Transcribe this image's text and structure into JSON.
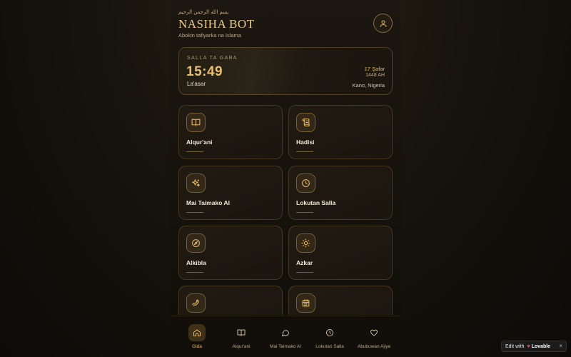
{
  "header": {
    "bismillah": "بسم الله الرحمن الرحيم",
    "title": "NASIHA BOT",
    "tagline": "Abokin tafiyarka na Islama",
    "profile_icon": "user-icon"
  },
  "prayer_card": {
    "label": "SALLA TA GABA",
    "time": "15:49",
    "name": "La'asar",
    "hijri_date": "17 Şafar",
    "hijri_year": "1448 AH",
    "location": "Kano, Nigeria"
  },
  "tiles": [
    {
      "label": "Alqur'ani",
      "icon": "book-open-icon"
    },
    {
      "label": "Hadisi",
      "icon": "scroll-icon"
    },
    {
      "label": "Mai Taimako AI",
      "icon": "sparkles-icon"
    },
    {
      "label": "Lokutan Salla",
      "icon": "clock-icon"
    },
    {
      "label": "Alkibla",
      "icon": "compass-icon"
    },
    {
      "label": "Azkar",
      "icon": "sun-icon"
    },
    {
      "label": "",
      "icon": "hand-coins-icon"
    },
    {
      "label": "",
      "icon": "calendar-icon"
    }
  ],
  "nav": {
    "items": [
      {
        "label": "Gida",
        "icon": "home-icon",
        "active": true
      },
      {
        "label": "Alqur'ani",
        "icon": "book-open-icon",
        "active": false
      },
      {
        "label": "Mai Taimako AI",
        "icon": "chat-bubble-icon",
        "active": false
      },
      {
        "label": "Lokutan Salla",
        "icon": "clock-icon",
        "active": false
      },
      {
        "label": "Abubuwan Ajiye",
        "icon": "heart-icon",
        "active": false
      }
    ]
  },
  "badge": {
    "prefix": "Edit with",
    "brand": "Lovable",
    "close": "×"
  },
  "colors": {
    "accent_gold": "#e3b866",
    "background": "#17130d",
    "card_border": "#8a6e3e"
  }
}
